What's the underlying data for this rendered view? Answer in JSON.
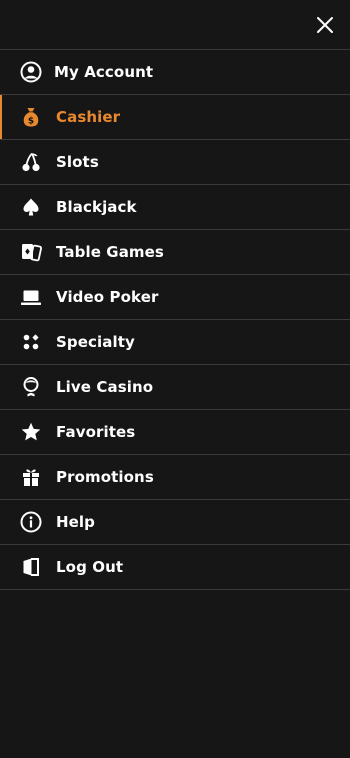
{
  "menu": {
    "close_icon": "close-icon",
    "items": [
      {
        "id": "my-account",
        "label": "My Account",
        "icon": "user-circle-icon",
        "active": false
      },
      {
        "id": "cashier",
        "label": "Cashier",
        "icon": "money-bag-icon",
        "active": true
      },
      {
        "id": "slots",
        "label": "Slots",
        "icon": "cherries-icon",
        "active": false
      },
      {
        "id": "blackjack",
        "label": "Blackjack",
        "icon": "spade-icon",
        "active": false
      },
      {
        "id": "table-games",
        "label": "Table Games",
        "icon": "cards-icon",
        "active": false
      },
      {
        "id": "video-poker",
        "label": "Video Poker",
        "icon": "laptop-icon",
        "active": false
      },
      {
        "id": "specialty",
        "label": "Specialty",
        "icon": "dots-grid-icon",
        "active": false
      },
      {
        "id": "live-casino",
        "label": "Live Casino",
        "icon": "dealer-icon",
        "active": false
      },
      {
        "id": "favorites",
        "label": "Favorites",
        "icon": "star-icon",
        "active": false
      },
      {
        "id": "promotions",
        "label": "Promotions",
        "icon": "gift-icon",
        "active": false
      },
      {
        "id": "help",
        "label": "Help",
        "icon": "info-icon",
        "active": false
      },
      {
        "id": "log-out",
        "label": "Log Out",
        "icon": "door-icon",
        "active": false
      }
    ]
  },
  "colors": {
    "background": "#161616",
    "divider": "#3a3a3a",
    "text": "#ffffff",
    "accent": "#e8892f"
  }
}
